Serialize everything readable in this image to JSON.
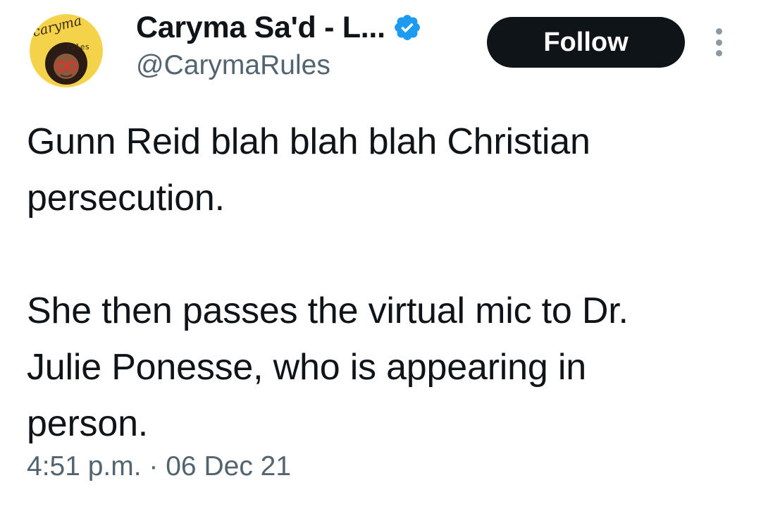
{
  "tweet": {
    "author": {
      "display_name": "Caryma Sa'd - L...",
      "handle": "@CarymaRules",
      "verified": true,
      "avatar_logo_text": "caryma rules"
    },
    "follow_label": "Follow",
    "body": "Gunn Reid blah blah blah Christian\npersecution.\n\nShe then passes the virtual mic to Dr.\nJulie Ponesse, who is appearing in\nperson.",
    "timestamp": "4:51 p.m. · 06 Dec 21"
  },
  "icons": {
    "verified": "verified-badge-icon",
    "more": "more-vertical-icon"
  },
  "colors": {
    "text": "#0f1419",
    "secondary_text": "#536471",
    "verified_blue": "#1d9bf0",
    "follow_bg": "#0f1419",
    "follow_text": "#ffffff"
  }
}
